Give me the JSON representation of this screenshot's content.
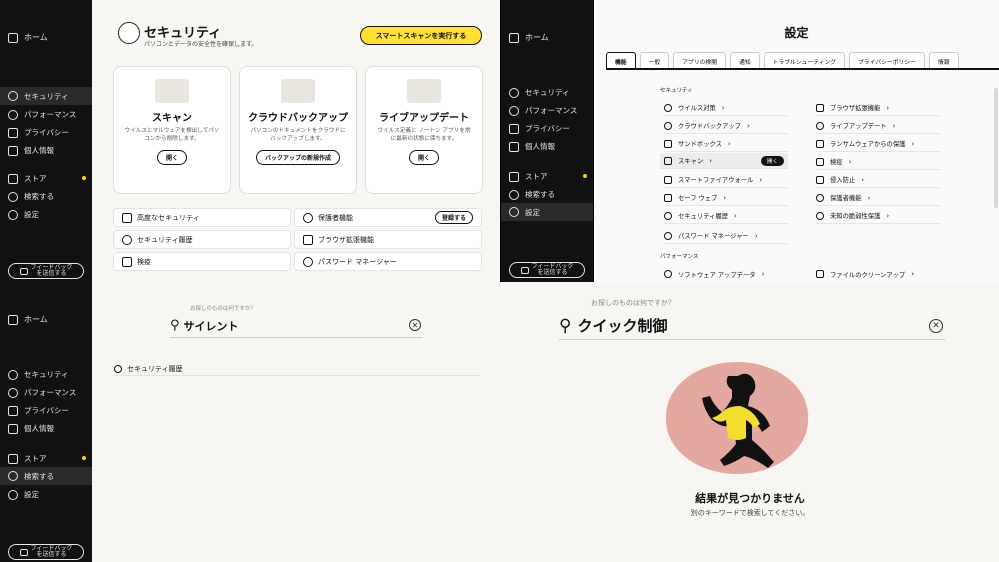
{
  "sidebar": {
    "home": "ホーム",
    "items": [
      "セキュリティ",
      "パフォーマンス",
      "プライバシー",
      "個人情報",
      "ストア",
      "検索する",
      "設定"
    ],
    "feedback": [
      "フィードバック",
      "を送信する"
    ]
  },
  "security": {
    "title": "セキュリティ",
    "subtitle": "パソコンとデータの安全性を確保します。",
    "smart_scan": "スマートスキャンを実行する",
    "cards": [
      {
        "title": "スキャン",
        "desc": "ウイルスとマルウェアを検出してパソコンから削除します。",
        "button": "開く"
      },
      {
        "title": "クラウドバックアップ",
        "desc": "パソコンのドキュメントをクラウドにバックアップします。",
        "button": "バックアップの新規作成"
      },
      {
        "title": "ライブアップデート",
        "desc": "ウイルス定義と ノートン アプリを常に最新の状態に保ちます。",
        "button": "開く"
      }
    ],
    "rows": [
      "高度なセキュリティ",
      "保護者機能",
      "セキュリティ履歴",
      "ブラウザ拡張機能",
      "検疫",
      "パスワード マネージャー"
    ],
    "register": "登録する"
  },
  "settings": {
    "title": "設定",
    "tabs": [
      "機能",
      "一般",
      "アプリの検閲",
      "通知",
      "トラブルシューティング",
      "プライバシーポリシー",
      "情報"
    ],
    "section_security": "セキュリティ",
    "left": [
      "ウイルス対策",
      "クラウドバックアップ",
      "サンドボックス",
      "スキャン",
      "スマートファイアウォール",
      "セーフ ウェブ",
      "セキュリティ履歴",
      "パスワード マネージャー"
    ],
    "right": [
      "ブラウザ拡張機能",
      "ライブアップデート",
      "ランサムウェアからの保護",
      "検疫",
      "侵入防止",
      "保護者機能",
      "未知の脆弱性保護"
    ],
    "open": "開く",
    "section_perf": "パフォーマンス",
    "perf_left": "ソフトウェア アップデータ",
    "perf_right": "ファイルのクリーンアップ"
  },
  "search_small": {
    "hint": "お探しのものは何ですか？",
    "query": "サイレント",
    "result": "セキュリティ履歴"
  },
  "search_large": {
    "hint": "お探しのものは何ですか？",
    "query": "クイック制御",
    "no_results": "結果が見つかりません",
    "no_results_sub": "別のキーワードで検索してください。"
  },
  "colors": {
    "accent": "#ffe135",
    "sidebar": "#111111",
    "hero": "#e3a8a0"
  }
}
